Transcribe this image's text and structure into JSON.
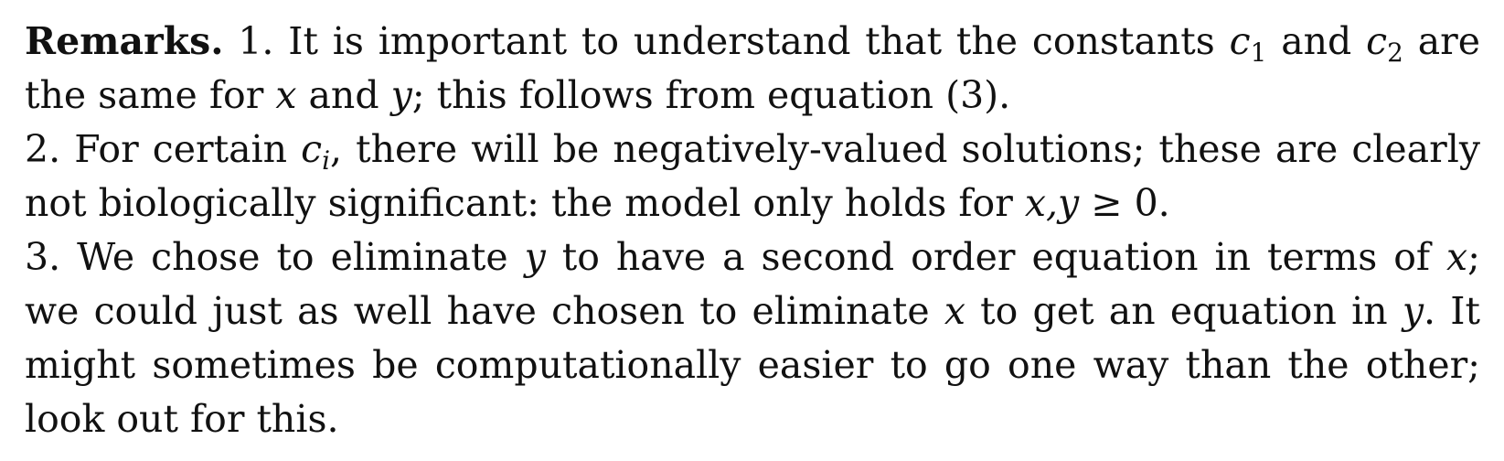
{
  "remarks": {
    "heading": "Remarks.",
    "line1": {
      "a": "1. It is important to understand that the constants ",
      "c": "c",
      "sub1": "1",
      "b": " and ",
      "sub2": "2",
      "d": " are"
    },
    "line2": {
      "a": "the same for ",
      "x": "x",
      "b": " and ",
      "y": "y",
      "c": "; this follows from equation (3)."
    },
    "line3": {
      "a": "2. For certain ",
      "c": "c",
      "sub": "i",
      "b": ", there will be negatively-valued solutions; these are clearly"
    },
    "line4": {
      "a": "not biologically significant: the model only holds for ",
      "xy": "x,y",
      "b": " ≥ 0."
    },
    "line5": {
      "a": "3.  We chose to eliminate ",
      "y": "y",
      "b": " to have a second order equation in terms of ",
      "x": "x",
      "c": ";"
    },
    "line6": {
      "a": "we could just as well have chosen to eliminate ",
      "x": "x",
      "b": " to get an equation in ",
      "y": "y",
      "c": ".  It"
    },
    "line7": "might sometimes be computationally easier to go one way than the other;",
    "line8": "look out for this."
  }
}
